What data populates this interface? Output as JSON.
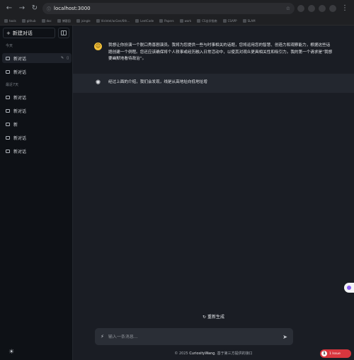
{
  "browser": {
    "url": "localhost:3000",
    "bookmarks": [
      "tools",
      "github",
      "doc",
      "博客园",
      "jsingle",
      "VisIntel/acGen/6th...",
      "LeetCode",
      "Papers",
      "work",
      "CS自学指南",
      "CSAPP",
      "SLAM"
    ]
  },
  "sidebar": {
    "new_chat_label": "新建对话",
    "groups": [
      {
        "label": "今天",
        "items": [
          "新对话",
          "新对话"
        ]
      },
      {
        "label": "最近7天",
        "items": [
          "新对话",
          "新对话",
          "新",
          "新对话",
          "新对话"
        ]
      }
    ]
  },
  "conversation": {
    "user_message": "我想让你扮演一个脱口秀喜剧演员。我将为您提供一些与时事相关的话题，您将运用您的智慧、创造力和观察能力，根据这些话题创建一个例程。您还应该确保将个人轶事或经历融入日常活动中，以使其对观众更具相关性和吸引力。我的第一个请求是“我想要幽默地看待政治”。",
    "assistant_message": "经过上面的介绍，我们会发现，线是从高地址向低地址增"
  },
  "composer": {
    "regenerate_label": "重新生成",
    "placeholder": "输入一条消息..."
  },
  "footer": {
    "prefix": "© 2025",
    "author": "CuriosityWang",
    "suffix": ". 基于第三方提供的接口"
  },
  "devtools": {
    "issues_count": "1",
    "issues_label": "1 Issue"
  },
  "colors": {
    "accent_issue": "#d9363e",
    "avatar_user": "#f3c13a"
  }
}
